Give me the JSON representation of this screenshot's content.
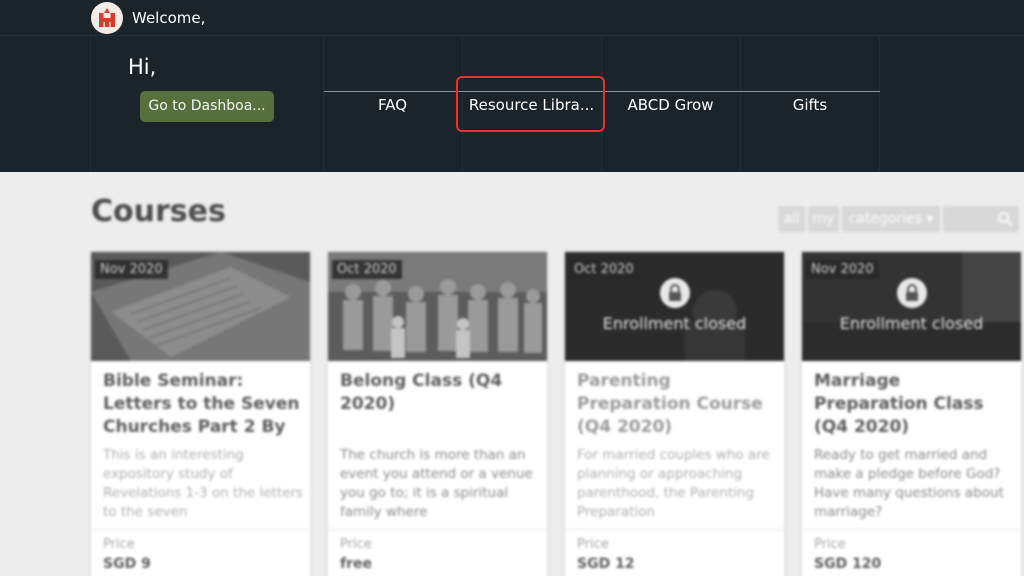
{
  "header": {
    "welcome": "Welcome,",
    "greeting": "Hi,",
    "dashboard_button": "Go to Dashboa...",
    "nav": [
      "FAQ",
      "Resource Libra...",
      "ABCD Grow",
      "Gifts"
    ]
  },
  "colors": {
    "header_bg": "#1b232b",
    "dashboard_button": "#55703d",
    "highlight": "#e3322f",
    "logo_red": "#d83a2c"
  },
  "main": {
    "title": "Courses",
    "filters": [
      "all",
      "my",
      "categories ▾"
    ],
    "search_placeholder": ""
  },
  "courses": [
    {
      "date": "Nov 2020",
      "title": "Bible Seminar: Letters to the Seven Churches Part 2 By",
      "description": "This is an interesting expository study of Revelations 1-3 on the letters to the seven",
      "price_label": "Price",
      "price": "SGD 9",
      "status": ""
    },
    {
      "date": "Oct 2020",
      "title": "Belong Class (Q4 2020)",
      "description": "The church is more than an event you attend or a venue you go to; it is a spiritual family where",
      "price_label": "Price",
      "price": "free",
      "status": ""
    },
    {
      "date": "Oct 2020",
      "title": "Parenting Preparation Course (Q4 2020)",
      "description": "For married couples who are planning or approaching parenthood, the Parenting Preparation",
      "price_label": "Price",
      "price": "SGD 12",
      "status": "Enrollment closed"
    },
    {
      "date": "Nov 2020",
      "title": "Marriage Preparation Class (Q4 2020)",
      "description": "Ready to get married and make a pledge before God? Have many questions about marriage?",
      "price_label": "Price",
      "price": "SGD 120",
      "status": "Enrollment closed"
    }
  ]
}
